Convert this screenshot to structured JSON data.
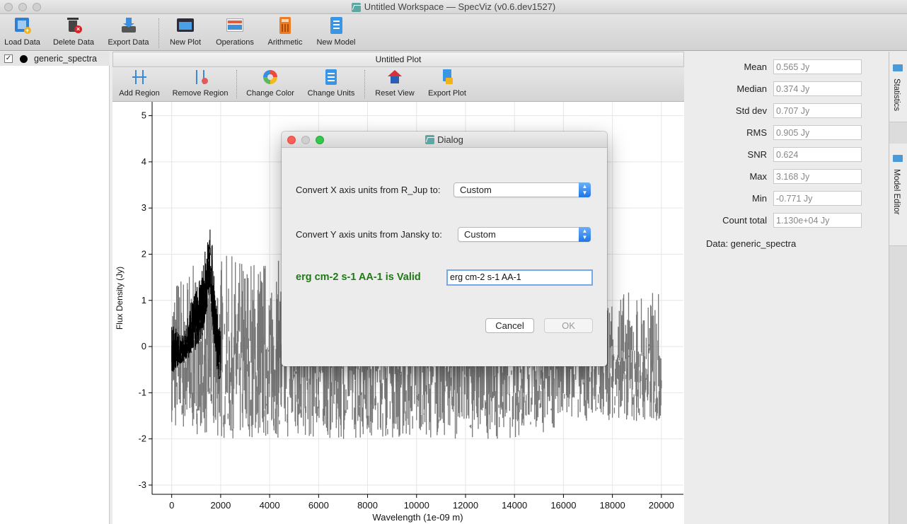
{
  "window": {
    "title": "Untitled Workspace — SpecViz (v0.6.dev1527)"
  },
  "toolbar": {
    "load_data": "Load Data",
    "delete_data": "Delete Data",
    "export_data": "Export Data",
    "new_plot": "New Plot",
    "operations": "Operations",
    "arithmetic": "Arithmetic",
    "new_model": "New Model"
  },
  "data_list": {
    "items": [
      {
        "label": "generic_spectra",
        "checked": "✓"
      }
    ]
  },
  "plot": {
    "title": "Untitled Plot",
    "toolbar": {
      "add_region": "Add Region",
      "remove_region": "Remove Region",
      "change_color": "Change Color",
      "change_units": "Change Units",
      "reset_view": "Reset View",
      "export_plot": "Export Plot"
    }
  },
  "chart_data": {
    "type": "line",
    "xlabel": "Wavelength (1e-09 m)",
    "ylabel": "Flux Density (Jy)",
    "xlim": [
      -800,
      20900
    ],
    "ylim": [
      -3.2,
      5.3
    ],
    "x_ticks": [
      0,
      2000,
      4000,
      6000,
      8000,
      10000,
      12000,
      14000,
      16000,
      18000,
      20000
    ],
    "y_ticks": [
      -3,
      -2,
      -1,
      0,
      1,
      2,
      3,
      4,
      5
    ],
    "grid": true,
    "series": [
      {
        "color": "#777777",
        "x": [
          0,
          1000,
          2000,
          4000,
          6000,
          8000,
          10000,
          12000,
          14000,
          16000,
          17000,
          18000,
          20000
        ],
        "y_upper": [
          1.5,
          1.8,
          2.0,
          1.9,
          1.8,
          1.8,
          1.8,
          1.8,
          1.8,
          1.7,
          1.3,
          1.2,
          1.2
        ],
        "y_lower": [
          -1.8,
          -1.9,
          -2.0,
          -2.0,
          -2.0,
          -2.0,
          -2.0,
          -2.0,
          -2.0,
          -1.8,
          -1.6,
          -1.6,
          -1.7
        ]
      },
      {
        "color": "#000000",
        "x": [
          0,
          200,
          400,
          600,
          800,
          1000,
          1200,
          1400,
          1550,
          1700,
          1900,
          2000
        ],
        "y_upper": [
          0.5,
          0.4,
          0.2,
          0.5,
          1.0,
          1.3,
          1.5,
          2.2,
          3.17,
          1.8,
          0.5,
          0.4
        ],
        "y_lower": [
          -0.6,
          -0.5,
          -0.4,
          -0.3,
          -0.2,
          -0.1,
          0.1,
          0.6,
          1.2,
          0.2,
          -0.7,
          -0.75
        ]
      }
    ]
  },
  "stats": {
    "rows": [
      {
        "label": "Mean",
        "value": "0.565 Jy"
      },
      {
        "label": "Median",
        "value": "0.374 Jy"
      },
      {
        "label": "Std dev",
        "value": "0.707 Jy"
      },
      {
        "label": "RMS",
        "value": "0.905 Jy"
      },
      {
        "label": "SNR",
        "value": "0.624"
      },
      {
        "label": "Max",
        "value": "3.168 Jy"
      },
      {
        "label": "Min",
        "value": "-0.771 Jy"
      },
      {
        "label": "Count total",
        "value": "1.130e+04 Jy"
      }
    ],
    "data_label": "Data: generic_spectra"
  },
  "side_tabs": {
    "statistics": "Statistics",
    "model_editor": "Model Editor"
  },
  "dialog": {
    "title": "Dialog",
    "x_label": "Convert X axis units from R_Jup to:",
    "x_select": "Custom",
    "y_label": "Convert Y axis units from Jansky to:",
    "y_select": "Custom",
    "valid_message": "erg cm-2 s-1 AA-1 is Valid",
    "custom_unit_value": "erg cm-2 s-1 AA-1",
    "cancel": "Cancel",
    "ok": "OK"
  }
}
